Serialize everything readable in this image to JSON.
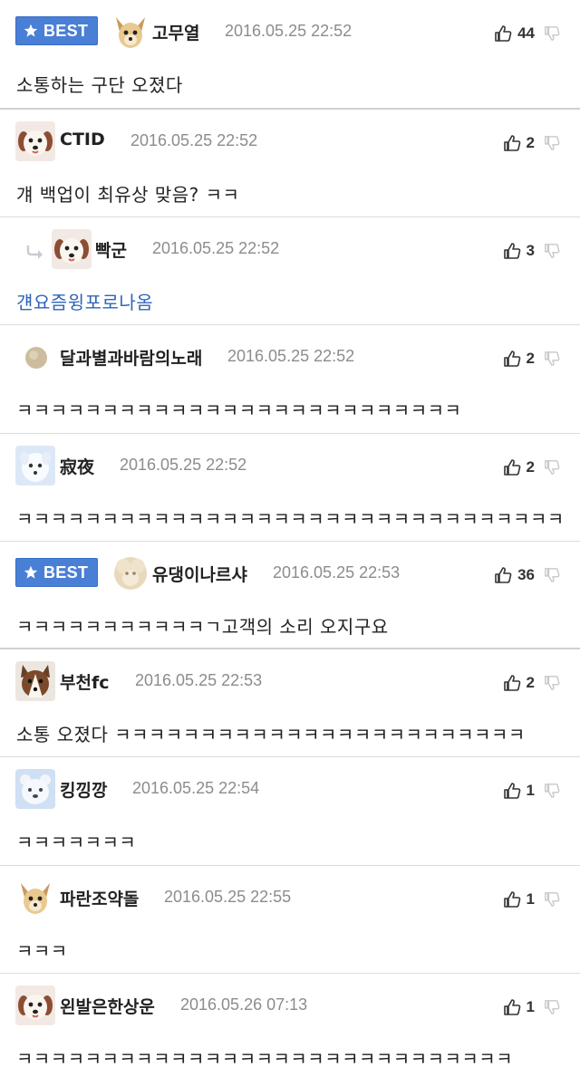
{
  "colors": {
    "best_badge": "#4a7fd6",
    "link": "#2f64b8",
    "date": "#8c8c8c",
    "divider": "#dcdcdc"
  },
  "best_label": "BEST",
  "comments": [
    {
      "best": true,
      "reply": false,
      "avatar": "chihuahua-avatar",
      "nick": "고무열",
      "date": "2016.05.25 22:52",
      "likes": "44",
      "body": "소통하는 구단 오졌다",
      "link": false
    },
    {
      "best": false,
      "reply": false,
      "avatar": "dog-avatar",
      "nick": "CTID",
      "date": "2016.05.25 22:52",
      "likes": "2",
      "body": "걔 백업이 최유상 맞음? ㅋㅋ",
      "link": false
    },
    {
      "best": false,
      "reply": true,
      "avatar": "dog-avatar",
      "nick": "빡군",
      "date": "2016.05.25 22:52",
      "likes": "3",
      "body": "걘요즘윙포로나옴",
      "link": true
    },
    {
      "best": false,
      "reply": false,
      "avatar": "round-avatar",
      "nick": "달과별과바람의노래",
      "date": "2016.05.25 22:52",
      "likes": "2",
      "body": "ㅋㅋㅋㅋㅋㅋㅋㅋㅋㅋㅋㅋㅋㅋㅋㅋㅋㅋㅋㅋㅋㅋㅋㅋㅋㅋ",
      "link": false
    },
    {
      "best": false,
      "reply": false,
      "avatar": "white-dog-avatar",
      "nick": "寂夜",
      "date": "2016.05.25 22:52",
      "likes": "2",
      "body": "ㅋㅋㅋㅋㅋㅋㅋㅋㅋㅋㅋㅋㅋㅋㅋㅋㅋㅋㅋㅋㅋㅋㅋㅋㅋㅋㅋㅋㅋㅋㅋㅋ",
      "link": false
    },
    {
      "best": true,
      "reply": false,
      "avatar": "fluffy-avatar",
      "nick": "유댕이나르샤",
      "date": "2016.05.25 22:53",
      "likes": "36",
      "body": "ㅋㅋㅋㅋㅋㅋㅋㅋㅋㅋㅋㄱ고객의 소리 오지구요",
      "link": false
    },
    {
      "best": false,
      "reply": false,
      "avatar": "husky-avatar",
      "nick": "부천fc",
      "date": "2016.05.25 22:53",
      "likes": "2",
      "body": "소통 오졌다 ㅋㅋㅋㅋㅋㅋㅋㅋㅋㅋㅋㅋㅋㅋㅋㅋㅋㅋㅋㅋㅋㅋㅋㅋ",
      "link": false
    },
    {
      "best": false,
      "reply": false,
      "avatar": "bear-avatar",
      "nick": "킹낑깡",
      "date": "2016.05.25 22:54",
      "likes": "1",
      "body": "ㅋㅋㅋㅋㅋㅋㅋ",
      "link": false
    },
    {
      "best": false,
      "reply": false,
      "avatar": "chihuahua-avatar",
      "nick": "파란조약돌",
      "date": "2016.05.25 22:55",
      "likes": "1",
      "body": "ㅋㅋㅋ",
      "link": false
    },
    {
      "best": false,
      "reply": false,
      "avatar": "dog-avatar",
      "nick": "왼발은한상운",
      "date": "2016.05.26 07:13",
      "likes": "1",
      "body": "ㅋㅋㅋㅋㅋㅋㅋㅋㅋㅋㅋㅋㅋㅋㅋㅋㅋㅋㅋㅋㅋㅋㅋㅋㅋㅋㅋㅋㅋ",
      "link": false
    }
  ]
}
